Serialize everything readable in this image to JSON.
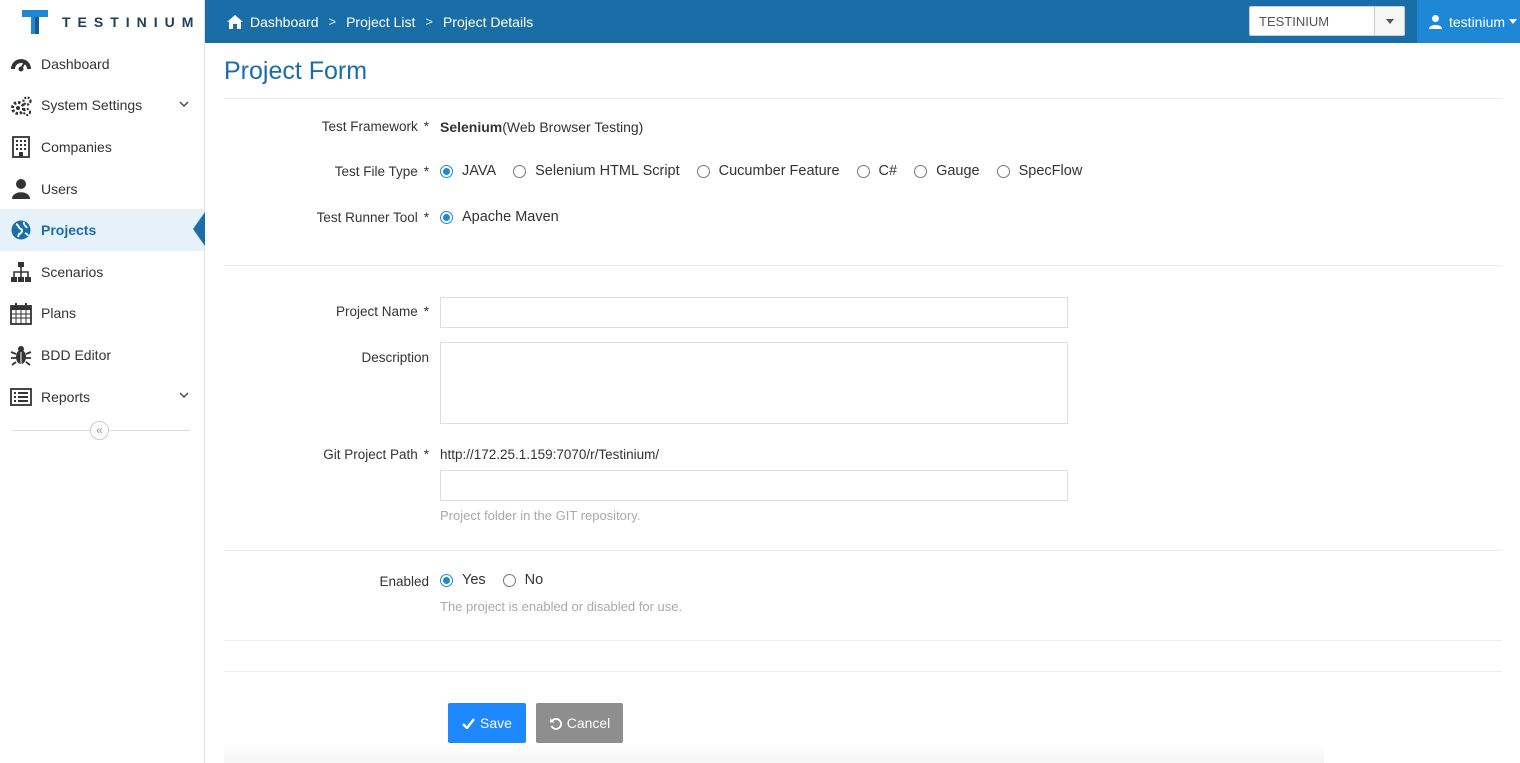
{
  "brand": {
    "name": "TESTINIUM",
    "color": "#1a6ea8"
  },
  "breadcrumb": {
    "home": "Dashboard",
    "items": [
      "Project List",
      "Project Details"
    ],
    "separator": ">"
  },
  "tenant": {
    "selected": "TESTINIUM"
  },
  "user": {
    "name": "testinium"
  },
  "sidebar": {
    "items": [
      {
        "label": "Dashboard",
        "icon": "dashboard-icon"
      },
      {
        "label": "System Settings",
        "icon": "gears-icon",
        "expandable": true
      },
      {
        "label": "Companies",
        "icon": "building-icon"
      },
      {
        "label": "Users",
        "icon": "user-icon"
      },
      {
        "label": "Projects",
        "icon": "globe-icon",
        "active": true
      },
      {
        "label": "Scenarios",
        "icon": "sitemap-icon"
      },
      {
        "label": "Plans",
        "icon": "calendar-icon"
      },
      {
        "label": "BDD Editor",
        "icon": "bug-icon"
      },
      {
        "label": "Reports",
        "icon": "list-icon",
        "expandable": true
      }
    ],
    "collapse_glyph": "«"
  },
  "form": {
    "title": "Project Form",
    "test_framework": {
      "label": "Test Framework",
      "value_bold": "Selenium",
      "value_rest": "(Web Browser Testing)"
    },
    "test_file_type": {
      "label": "Test File Type",
      "options": [
        "JAVA",
        "Selenium HTML Script",
        "Cucumber Feature",
        "C#",
        "Gauge",
        "SpecFlow"
      ],
      "selected": "JAVA"
    },
    "test_runner_tool": {
      "label": "Test Runner Tool",
      "options": [
        "Apache Maven"
      ],
      "selected": "Apache Maven"
    },
    "project_name": {
      "label": "Project Name",
      "value": ""
    },
    "description": {
      "label": "Description",
      "value": ""
    },
    "git_project_path": {
      "label": "Git Project Path",
      "base_url": "http://172.25.1.159:7070/r/Testinium/",
      "value": "",
      "help": "Project folder in the GIT repository."
    },
    "enabled": {
      "label": "Enabled",
      "options": [
        "Yes",
        "No"
      ],
      "selected": "Yes",
      "help": "The project is enabled or disabled for use."
    },
    "required_marker": "*",
    "save_label": "Save",
    "cancel_label": "Cancel"
  }
}
